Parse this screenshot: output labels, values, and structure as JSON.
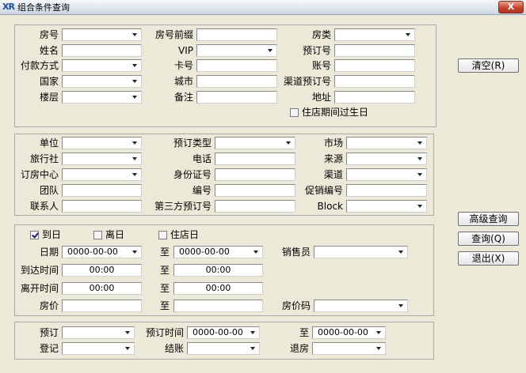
{
  "window": {
    "title": "组合条件查询",
    "app_icon": "XR",
    "close": "X"
  },
  "section1": {
    "room_no": "房号",
    "room_prefix": "房号前缀",
    "room_type": "房类",
    "name": "姓名",
    "vip": "VIP",
    "reservation_no": "预订号",
    "payment": "付款方式",
    "card_no": "卡号",
    "account_no": "账号",
    "country": "国家",
    "city": "城市",
    "channel_res_no": "渠道预订号",
    "floor": "楼层",
    "remark": "备注",
    "address": "地址",
    "birthday_during_stay": "住店期间过生日"
  },
  "section2": {
    "company": "单位",
    "res_type": "预订类型",
    "market": "市场",
    "travel_agency": "旅行社",
    "phone": "电话",
    "source": "来源",
    "booking_center": "订房中心",
    "id_card": "身份证号",
    "channel": "渠道",
    "group": "团队",
    "code": "编号",
    "promo_code": "促销编号",
    "contact": "联系人",
    "third_party_res_no": "第三方预订号",
    "block": "Block"
  },
  "section3": {
    "arrival_day": "到日",
    "departure_day": "离日",
    "in_house_day": "住店日",
    "date": "日期",
    "date_from": "0000-00-00",
    "to": "至",
    "date_to": "0000-00-00",
    "salesperson": "销售员",
    "arrival_time": "到达时间",
    "arrival_from": "00:00",
    "arrival_to": "00:00",
    "departure_time": "离开时间",
    "departure_from": "00:00",
    "departure_to": "00:00",
    "rate": "房价",
    "rate_code": "房价码"
  },
  "section4": {
    "reserve": "预订",
    "reserve_time": "预订时间",
    "reserve_time_from": "0000-00-00",
    "to": "至",
    "reserve_time_to": "0000-00-00",
    "register": "登记",
    "checkout": "结账",
    "check_out_room": "退房"
  },
  "buttons": {
    "clear": "清空(R)",
    "advanced": "高级查询",
    "query": "查询(Q)",
    "exit": "退出(X)"
  }
}
